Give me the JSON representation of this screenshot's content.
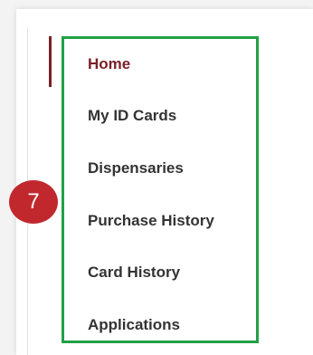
{
  "nav": {
    "items": [
      {
        "label": "Home",
        "active": true
      },
      {
        "label": "My ID Cards",
        "active": false
      },
      {
        "label": "Dispensaries",
        "active": false
      },
      {
        "label": "Purchase History",
        "active": false
      },
      {
        "label": "Card History",
        "active": false
      },
      {
        "label": "Applications",
        "active": false
      }
    ]
  },
  "annotation": {
    "step_number": "7"
  },
  "colors": {
    "accent": "#7a1f26",
    "highlight_border": "#22a046",
    "badge": "#c1282e",
    "text": "#333333"
  }
}
